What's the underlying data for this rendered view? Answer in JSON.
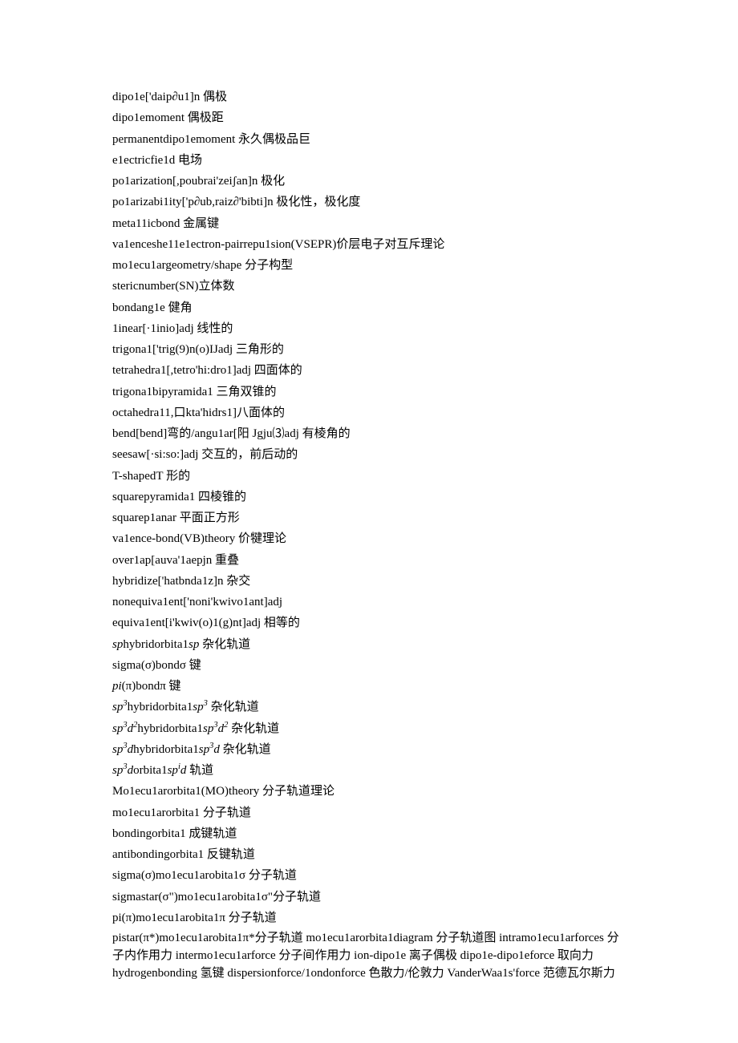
{
  "lines": [
    {
      "text": "dipo1e['daip∂u1]n 偶极"
    },
    {
      "text": "dipo1emoment 偶极距"
    },
    {
      "text": "permanentdipo1emoment 永久偶极品巨"
    },
    {
      "text": "e1ectricfie1d 电场"
    },
    {
      "text": "po1arization[,poubrai'zeiʃan]n 极化"
    },
    {
      "text": "po1arizabi1ity['p∂ub,raiz∂'bibti]n 极化性，极化度"
    },
    {
      "text": "meta11icbond 金属键"
    },
    {
      "text": "va1enceshe11e1ectron-pairrepu1sion(VSEPR)价层电子对互斥理论"
    },
    {
      "text": "mo1ecu1argeometry/shape 分子构型"
    },
    {
      "text": "stericnumber(SN)立体数"
    },
    {
      "text": "bondang1e 健角"
    },
    {
      "text": "1inear[·1inio]adj 线性的"
    },
    {
      "text": "trigona1['trig(9)n(o)IJadj 三角形的"
    },
    {
      "text": "tetrahedra1[,tetro'hi:dro1]adj 四面体的"
    },
    {
      "text": "trigona1bipyramida1 三角双锥的"
    },
    {
      "text": "octahedra11,口kta'hidrs1]八面体的"
    },
    {
      "text": "bend[bend]弯的/angu1ar[阳 Jgju⑶adj 有棱角的"
    },
    {
      "text": "seesaw[·si:so:]adj 交互的，前后动的"
    },
    {
      "text": "T-shapedT 形的"
    },
    {
      "text": "squarepyramida1 四棱锥的"
    },
    {
      "text": "squarep1anar 平面正方形"
    },
    {
      "text": "va1ence-bond(VB)theory 价犍理论"
    },
    {
      "text": "over1ap[auva'1aepjn 重叠"
    },
    {
      "text": "hybridize['hatbnda1z]n 杂交"
    },
    {
      "text": "nonequiva1ent['noni'kwivo1ant]adj"
    },
    {
      "text": "equiva1ent[i'kwiv(o)1(g)nt]adj 相等的"
    },
    {
      "html": "<span class=\"italic\">sp</span>hybridorbita1<span class=\"italic\">sp</span> 杂化轨道"
    },
    {
      "text": "sigma(σ)bondσ 键"
    },
    {
      "html": "<span class=\"italic\">pi</span>(π)bondπ 键"
    },
    {
      "html": "<span class=\"italic\">sp<sup>3</sup></span>hybridorbita1<span class=\"italic\">sp<sup>3</sup></span> 杂化轨道"
    },
    {
      "html": "<span class=\"italic\">sp<sup>3</sup>d<sup>2</sup></span>hybridorbita1<span class=\"italic\">sp<sup>3</sup>d<sup>2</sup></span> 杂化轨道"
    },
    {
      "html": "<span class=\"italic\">sp<sup>3</sup>d</span>hybridorbita1<span class=\"italic\">sp<sup>3</sup>d</span> 杂化轨道"
    },
    {
      "html": "<span class=\"italic\">sp<sup>3</sup>d</span>orbita1<span class=\"italic\">sp<sup>i</sup>d</span> 轨道"
    },
    {
      "text": "Mo1ecu1arorbita1(MO)theory 分子轨道理论"
    },
    {
      "text": "mo1ecu1arorbita1 分子轨道"
    },
    {
      "text": "bondingorbita1 成键轨道"
    },
    {
      "text": "antibondingorbita1 反键轨道"
    },
    {
      "text": "sigma(σ)mo1ecu1arobita1σ 分子轨道"
    },
    {
      "text": "sigmastar(σ\")mo1ecu1arobita1σ\"分子轨道"
    },
    {
      "text": "pi(π)mo1ecu1arobita1π 分子轨道"
    },
    {
      "text": "pistar(π*)mo1ecu1arobita1π*分子轨道 mo1ecu1arorbita1diagram 分子轨道图 intramo1ecu1arforces 分子内作用力 intermo1ecu1arforce 分子间作用力 ion-dipo1e 离子偶极 dipo1e-dipo1eforce 取向力 hydrogenbonding 氢键 dispersionforce/1ondonforce 色散力/伦敦力 VanderWaa1s'force 范德瓦尔斯力",
      "block": true
    }
  ]
}
